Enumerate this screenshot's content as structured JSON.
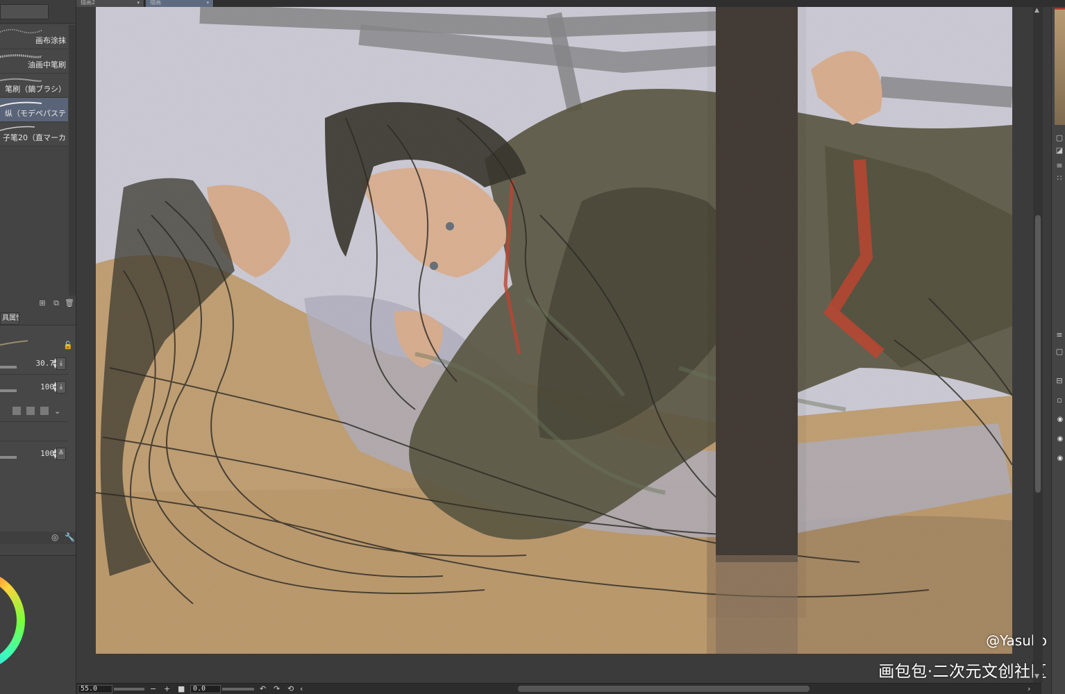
{
  "tabs": [
    {
      "label": "描画2"
    },
    {
      "label": "描画"
    }
  ],
  "brushes": [
    {
      "label": "画布涂抹"
    },
    {
      "label": "油画中笔刷"
    },
    {
      "label": "笔刷（鏑ブラシ）"
    },
    {
      "label": "纵（モデペパステ"
    },
    {
      "label": "子笔20（直マーカ"
    }
  ],
  "selected_brush_index": 3,
  "tool_property": {
    "tab_label": "具属性",
    "brush_size": "30.7",
    "opacity": "100",
    "density": "100"
  },
  "statusbar": {
    "zoom": "55.0",
    "angle": "0.0"
  },
  "watermark": {
    "handle": "@Yasuko",
    "site": "画包包·二次元文创社区"
  },
  "colors": {
    "panel_bg": "#444444",
    "selected": "#5a6478",
    "canvas_sky": "#d5d3de",
    "ground": "#c9a77a",
    "pillar": "#4a423b"
  },
  "icons": {
    "new": "new-layer-icon",
    "copy": "copy-icon",
    "delete": "trash-icon",
    "lock": "lock-icon",
    "settings": "wrench-icon",
    "eye": "eye-icon"
  }
}
